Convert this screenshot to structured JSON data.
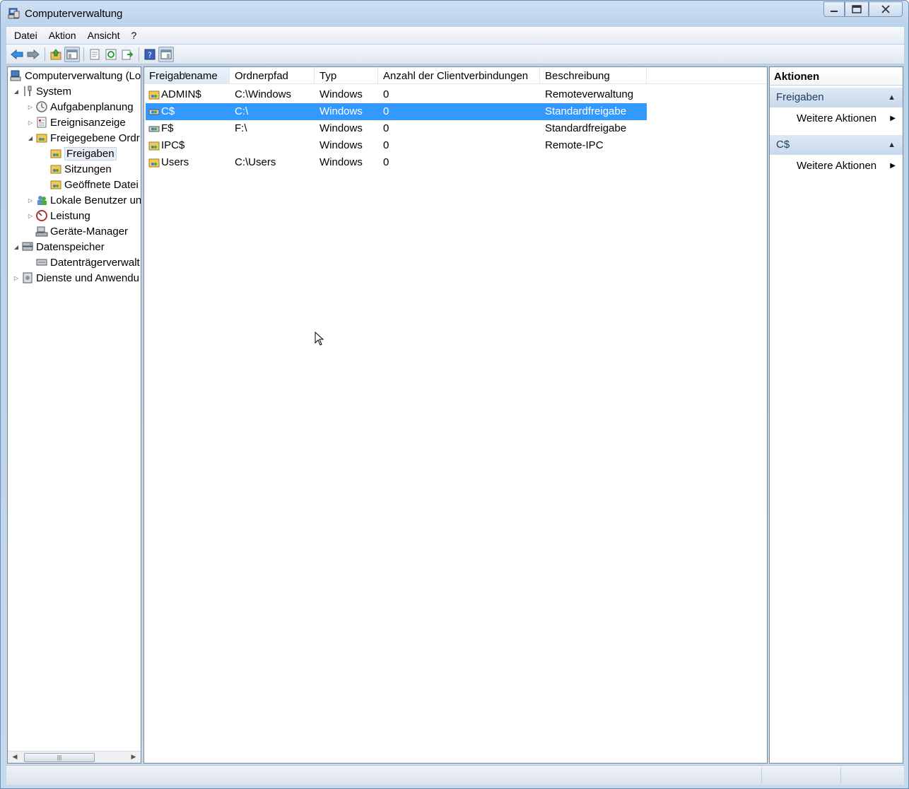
{
  "window": {
    "title": "Computerverwaltung",
    "buttons": [
      "minimize",
      "maximize",
      "close"
    ]
  },
  "menu": {
    "items": [
      "Datei",
      "Aktion",
      "Ansicht",
      "?"
    ]
  },
  "toolbar": {
    "buttons": [
      "back-icon",
      "forward-icon",
      "up-folder-icon",
      "show-hide-tree-icon",
      "properties-icon",
      "refresh-icon",
      "export-list-icon",
      "help-icon",
      "show-hide-action-pane-icon"
    ]
  },
  "tree": {
    "root": "Computerverwaltung (Lo",
    "system": "System",
    "aufgabenplanung": "Aufgabenplanung",
    "ereignisanzeige": "Ereignisanzeige",
    "freigegebene": "Freigegebene Ordr",
    "freigaben": "Freigaben",
    "sitzungen": "Sitzungen",
    "geoeffnete": "Geöffnete Datei",
    "lokale": "Lokale Benutzer un",
    "leistung": "Leistung",
    "geraete": "Geräte-Manager",
    "datenspeicher": "Datenspeicher",
    "datentraeger": "Datenträgerverwalt",
    "dienste": "Dienste und Anwendu"
  },
  "list": {
    "columns": [
      "Freigabename",
      "Ordnerpfad",
      "Typ",
      "Anzahl der Clientverbindungen",
      "Beschreibung"
    ],
    "rows": [
      {
        "name": "ADMIN$",
        "path": "C:\\Windows",
        "type": "Windows",
        "connections": "0",
        "description": "Remoteverwaltung"
      },
      {
        "name": "C$",
        "path": "C:\\",
        "type": "Windows",
        "connections": "0",
        "description": "Standardfreigabe"
      },
      {
        "name": "F$",
        "path": "F:\\",
        "type": "Windows",
        "connections": "0",
        "description": "Standardfreigabe"
      },
      {
        "name": "IPC$",
        "path": "",
        "type": "Windows",
        "connections": "0",
        "description": "Remote-IPC"
      },
      {
        "name": "Users",
        "path": "C:\\Users",
        "type": "Windows",
        "connections": "0",
        "description": ""
      }
    ],
    "selected_index": 1
  },
  "actions": {
    "title": "Aktionen",
    "sections": [
      {
        "label": "Freigaben",
        "item": "Weitere Aktionen"
      },
      {
        "label": "C$",
        "item": "Weitere Aktionen"
      }
    ]
  }
}
